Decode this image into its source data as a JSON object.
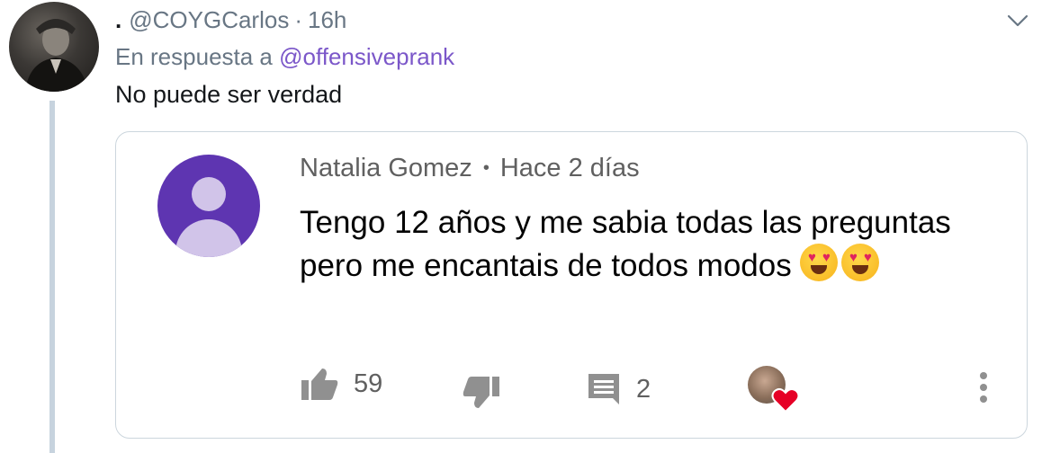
{
  "tweet": {
    "display_name": ".",
    "handle": "@COYGCarlos",
    "separator": "·",
    "time": "16h",
    "reply_prefix": "En respuesta a",
    "reply_handle": "@offensiveprank",
    "text": "No puede ser verdad"
  },
  "embedded_comment": {
    "author": "Natalia Gomez",
    "separator": "•",
    "time": "Hace 2 días",
    "text": "Tengo 12 años y me sabia todas las preguntas pero me encantais de todos modos",
    "emojis": [
      "smiling-face-with-heart-eyes",
      "smiling-face-with-heart-eyes"
    ],
    "likes": "59",
    "replies": "2"
  },
  "icons": {
    "menu": "chevron-down-icon",
    "like": "thumbs-up-icon",
    "dislike": "thumbs-down-icon",
    "reply": "comment-icon",
    "creator_heart": "heart-icon",
    "more": "more-vert-icon"
  },
  "colors": {
    "link": "#7b57c9",
    "secondary_text": "#687684",
    "thread_line": "#c7d3de",
    "yt_avatar_bg": "#5e35b1",
    "yt_avatar_fg": "#d1c4e9",
    "heart": "#e0245e"
  }
}
